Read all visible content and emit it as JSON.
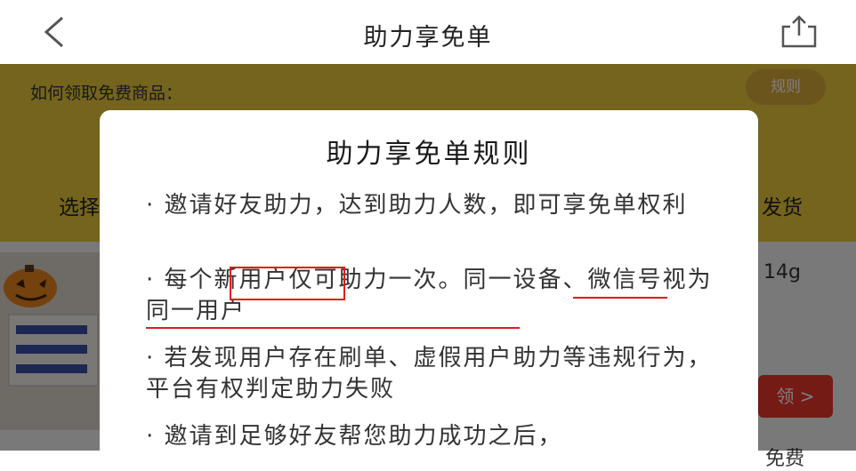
{
  "nav": {
    "back_icon": "chevron-left-icon",
    "title": "助力享免单",
    "share_icon": "share-icon"
  },
  "background": {
    "how_to": "如何领取免费商品：",
    "rule_chip": "规则",
    "steps_left": "选择",
    "steps_right": "发货",
    "product_weight": "14g",
    "claim_button": "领 >",
    "tail_text": "免费"
  },
  "modal": {
    "title": "助力享免单规则",
    "rules": [
      "· 邀请好友助力，达到助力人数，即可享免单权利",
      "· 每个新用户仅可助力一次。同一设备、微信号视为同一用户",
      "· 若发现用户存在刷单、虚假用户助力等违规行为，平台有权判定助力失败",
      "· 邀请到足够好友帮您助力成功之后，"
    ]
  },
  "colors": {
    "banner": "#e8c93c",
    "accent_red": "#e01b1b",
    "overlay": "rgba(0,0,0,0.5)"
  }
}
